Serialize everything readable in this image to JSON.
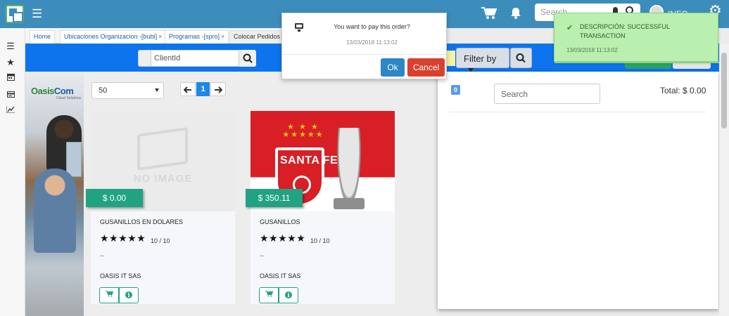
{
  "topbar": {
    "search_placeholder": "Search",
    "user_name": "INFO",
    "colors": {
      "background": "#3c8dbc"
    }
  },
  "sidenav": {
    "icons": [
      "list-icon",
      "star-icon",
      "calendar-icon",
      "card-icon",
      "chart-line-icon"
    ]
  },
  "tabs": [
    {
      "label": "Home"
    },
    {
      "label": "Ubicaciones Organizacion -[bubi]",
      "close": "×"
    },
    {
      "label": "Programas -[spro]",
      "close": "×"
    },
    {
      "label": "Colocar Pedidos"
    }
  ],
  "filterbar": {
    "client_placeholder": "ClientId",
    "filter_by_label": "Filter by",
    "colors": {
      "background": "#0d74ee"
    }
  },
  "banner": {
    "brand_oasis": "Oasis",
    "brand_com": "Com",
    "brand_sub": "Cloud Solutions"
  },
  "listing": {
    "page_size": "50",
    "current_page": "1"
  },
  "products": [
    {
      "image": "NO IMAGE",
      "price": "$ 0.00",
      "name": "GUSANILLOS EN DOLARES",
      "stars": "★★★★★",
      "rating": "10 / 10",
      "extra": "--",
      "company": "OASIS IT SAS"
    },
    {
      "image": "SANTA FE",
      "price": "$ 350.11",
      "name": "GUSANILLOS",
      "stars": "★★★★★",
      "rating": "10 / 10",
      "extra": "--",
      "company": "OASIS IT SAS"
    }
  ],
  "cart": {
    "count": "0",
    "search_placeholder": "Search",
    "total": "Total: $ 0.00"
  },
  "dialog": {
    "message": "You want to pay this order?",
    "timestamp": "13/03/2018 11:13:02",
    "ok_label": "Ok",
    "cancel_label": "Cancel"
  },
  "toast": {
    "message": "DESCRIPCIÓN: SUCCESSFUL TRANSACTION",
    "timestamp": "13/03/2018 11:13:02",
    "colors": {
      "background": "#b9efaf"
    }
  }
}
